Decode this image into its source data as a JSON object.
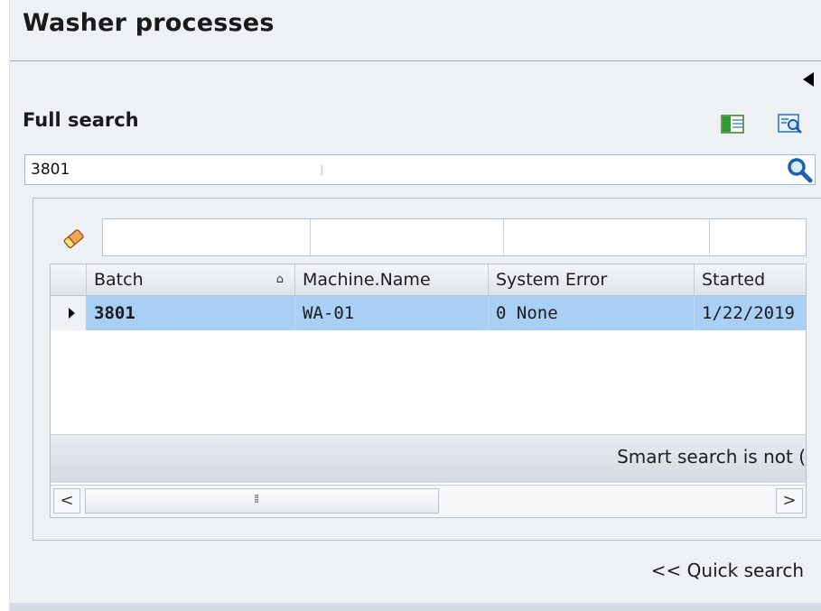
{
  "panel": {
    "title": "Washer processes",
    "subtitle": "Full search"
  },
  "icons": {
    "collapse": "triangle-left-icon",
    "columns": "column-chooser-icon",
    "find": "find-document-icon",
    "search": "magnifier-icon",
    "eraser": "eraser-icon"
  },
  "search": {
    "value": "3801",
    "placeholder": ""
  },
  "grid": {
    "columns": [
      "Batch",
      "Machine.Name",
      "System Error",
      "Started"
    ],
    "sort_glyph": "⌂",
    "rows": [
      {
        "batch": "3801",
        "machine": "WA-01",
        "system_error": "0 None",
        "started": "1/22/2019"
      }
    ],
    "footer_text": "Smart search is not (",
    "scroll_left": "<",
    "scroll_right": ">",
    "scroll_grip": "⁞⁞"
  },
  "links": {
    "quick_search": "<< Quick search"
  },
  "colors": {
    "selected_row": "#a9cff5",
    "accent_blue": "#2a6fc4"
  }
}
